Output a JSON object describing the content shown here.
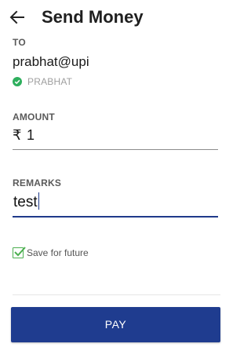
{
  "header": {
    "title": "Send Money",
    "back_icon": "arrow-left-icon"
  },
  "to": {
    "label": "TO",
    "vpa": "prabhat@upi",
    "verified_icon": "check-circle-icon",
    "verified_name": "PRABHAT",
    "verified_color": "#2eaf5d"
  },
  "amount": {
    "label": "AMOUNT",
    "currency_symbol": "₹",
    "value": "1"
  },
  "remarks": {
    "label": "REMARKS",
    "value": "test",
    "focused": true,
    "accent_color": "#1f3a8a"
  },
  "save_for_future": {
    "label": "Save for future",
    "checked": true,
    "check_color": "#4caf50"
  },
  "pay_button": {
    "label": "PAY",
    "color": "#1f3c8f"
  }
}
